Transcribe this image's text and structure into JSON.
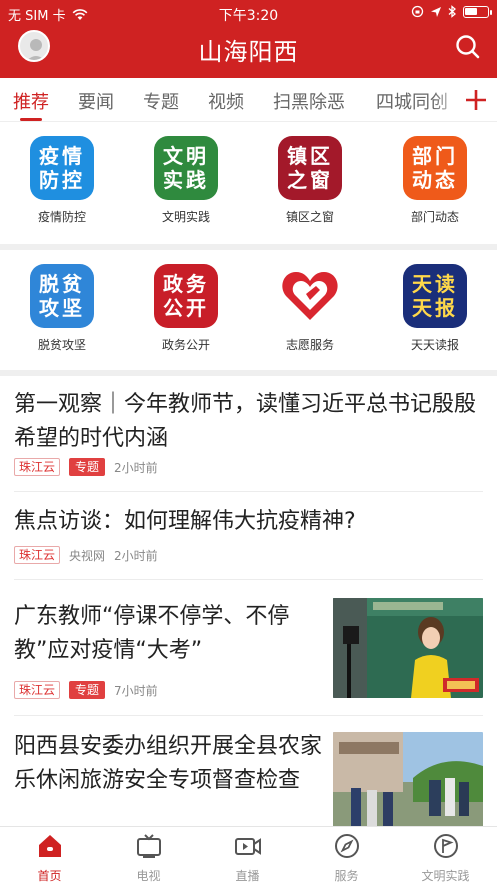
{
  "status_bar": {
    "carrier": "无 SIM 卡",
    "time": "下午3:20",
    "battery_level": 0.55
  },
  "header": {
    "title": "山海阳西"
  },
  "tabs": [
    {
      "label": "推荐",
      "active": true
    },
    {
      "label": "要闻"
    },
    {
      "label": "专题"
    },
    {
      "label": "视频"
    },
    {
      "label": "扫黑除恶"
    },
    {
      "label": "四城同创"
    }
  ],
  "grid_rows": [
    [
      {
        "icon_text": "疫情防控",
        "label": "疫情防控",
        "color": "#1f8fe0"
      },
      {
        "icon_text": "文明实践",
        "label": "文明实践",
        "color": "#2f8a3e"
      },
      {
        "icon_text": "镇区之窗",
        "label": "镇区之窗",
        "color": "#a3192a"
      },
      {
        "icon_text": "部门动态",
        "label": "部门动态",
        "color": "#ef5a1a"
      }
    ],
    [
      {
        "icon_text": "脱贫攻坚",
        "label": "脱贫攻坚",
        "color": "#2f86d8"
      },
      {
        "icon_text": "政务公开",
        "label": "政务公开",
        "color": "#c81e28"
      },
      {
        "icon_text": "",
        "label": "志愿服务",
        "color": "#ffffff",
        "icon": "heart-hand-icon"
      },
      {
        "icon_text": "天读天报",
        "label": "天天读报",
        "color": "#1a2e7a"
      }
    ]
  ],
  "articles": [
    {
      "title": "第一观察｜今年教师节，读懂习近平总书记殷殷希望的时代内涵",
      "source": "珠江云",
      "topic": "专题",
      "time": "2小时前"
    },
    {
      "title": "焦点访谈：如何理解伟大抗疫精神?",
      "source": "珠江云",
      "publisher": "央视网",
      "time": "2小时前"
    },
    {
      "title": "广东教师“停课不停学、不停教”应对疫情“大考”",
      "source": "珠江云",
      "topic": "专题",
      "time": "7小时前"
    },
    {
      "title": "阳西县安委办组织开展全县农家乐休闲旅游安全专项督查检查"
    }
  ],
  "bottom_nav": [
    {
      "label": "首页",
      "icon": "home-icon",
      "active": true
    },
    {
      "label": "电视",
      "icon": "tv-icon"
    },
    {
      "label": "直播",
      "icon": "live-icon"
    },
    {
      "label": "服务",
      "icon": "compass-icon"
    },
    {
      "label": "文明实践",
      "icon": "flag-icon"
    }
  ],
  "colors": {
    "brand": "#cf2222"
  }
}
